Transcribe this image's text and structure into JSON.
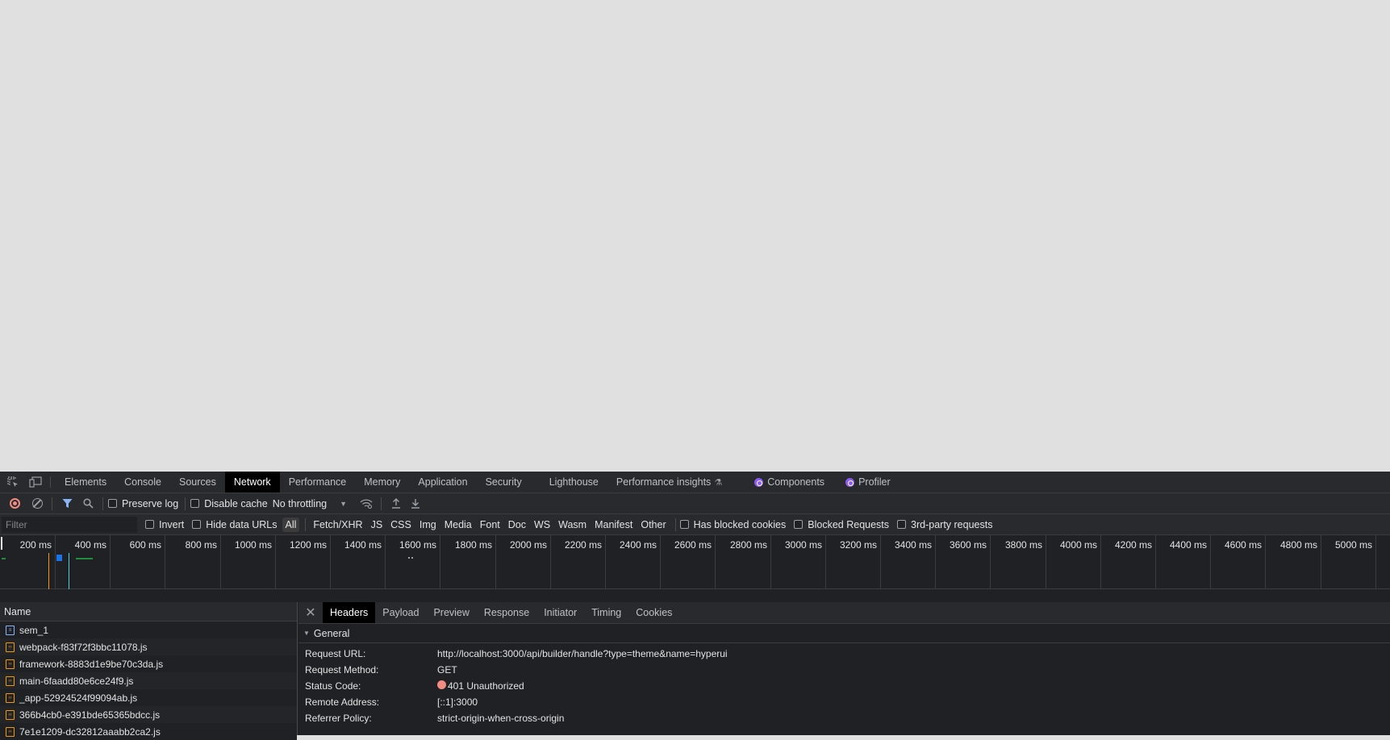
{
  "devtools": {
    "tabs": [
      {
        "label": "Elements"
      },
      {
        "label": "Console"
      },
      {
        "label": "Sources"
      },
      {
        "label": "Network",
        "active": true
      },
      {
        "label": "Performance"
      },
      {
        "label": "Memory"
      },
      {
        "label": "Application"
      },
      {
        "label": "Security"
      },
      {
        "label": "Lighthouse"
      },
      {
        "label": "Performance insights"
      },
      {
        "label": "Components"
      },
      {
        "label": "Profiler"
      }
    ],
    "toolbar": {
      "preserve_log": "Preserve log",
      "disable_cache": "Disable cache",
      "throttling": "No throttling"
    },
    "filter": {
      "placeholder": "Filter",
      "invert": "Invert",
      "hide_data_urls": "Hide data URLs",
      "types": [
        "All",
        "Fetch/XHR",
        "JS",
        "CSS",
        "Img",
        "Media",
        "Font",
        "Doc",
        "WS",
        "Wasm",
        "Manifest",
        "Other"
      ],
      "active_type": "All",
      "has_blocked_cookies": "Has blocked cookies",
      "blocked_requests": "Blocked Requests",
      "third_party": "3rd-party requests"
    },
    "timeline": {
      "ticks": [
        "200 ms",
        "400 ms",
        "600 ms",
        "800 ms",
        "1000 ms",
        "1200 ms",
        "1400 ms",
        "1600 ms",
        "1800 ms",
        "2000 ms",
        "2200 ms",
        "2400 ms",
        "2600 ms",
        "2800 ms",
        "3000 ms",
        "3200 ms",
        "3400 ms",
        "3600 ms",
        "3800 ms",
        "4000 ms",
        "4200 ms",
        "4400 ms",
        "4600 ms",
        "4800 ms",
        "5000 ms"
      ]
    },
    "requests": {
      "header": "Name",
      "rows": [
        {
          "name": "sem_1",
          "type": "doc"
        },
        {
          "name": "webpack-f83f72f3bbc11078.js",
          "type": "js"
        },
        {
          "name": "framework-8883d1e9be70c3da.js",
          "type": "js"
        },
        {
          "name": "main-6faadd80e6ce24f9.js",
          "type": "js"
        },
        {
          "name": "_app-52924524f99094ab.js",
          "type": "js"
        },
        {
          "name": "366b4cb0-e391bde65365bdcc.js",
          "type": "js"
        },
        {
          "name": "7e1e1209-dc32812aaabb2ca2.js",
          "type": "js"
        }
      ]
    },
    "details": {
      "tabs": [
        "Headers",
        "Payload",
        "Preview",
        "Response",
        "Initiator",
        "Timing",
        "Cookies"
      ],
      "active_tab": "Headers",
      "section": "General",
      "general": [
        {
          "key": "Request URL:",
          "value": "http://localhost:3000/api/builder/handle?type=theme&name=hyperui"
        },
        {
          "key": "Request Method:",
          "value": "GET"
        },
        {
          "key": "Status Code:",
          "value": "401 Unauthorized",
          "status_color": "#f28b82"
        },
        {
          "key": "Remote Address:",
          "value": "[::1]:3000"
        },
        {
          "key": "Referrer Policy:",
          "value": "strict-origin-when-cross-origin"
        }
      ]
    }
  }
}
